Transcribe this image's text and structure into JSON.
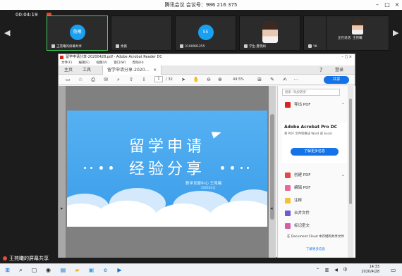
{
  "meeting": {
    "title": "腾讯会议 会议号：986 216 375",
    "timer": "00:04:19",
    "screen_share_label": "王苑曦的屏幕共享"
  },
  "participants": [
    {
      "avatar_text": "苑曦",
      "name": "王苑曦的屏幕共享",
      "avatar_color": "#1aa0f0",
      "active": true
    },
    {
      "avatar_text": "",
      "name": "余薇",
      "avatar_color": "#000000",
      "active": false
    },
    {
      "avatar_text": "55",
      "name": "3190901255",
      "avatar_color": "#1aa0f0",
      "active": false
    },
    {
      "avatar_text": "",
      "name": "学生·夏晓如",
      "avatar_color": "photo",
      "active": false
    },
    {
      "avatar_text": "",
      "name": "YK",
      "avatar_color": "#000000",
      "active": false
    },
    {
      "avatar_text": "",
      "name": "正在说话: 王苑曦",
      "avatar_color": "photo",
      "active": false
    }
  ],
  "acrobat": {
    "window_title": "留学申请分享-20200428.pdf - Adobe Acrobat Reader DC",
    "menu": [
      "文件(F)",
      "编辑(E)",
      "视图(V)",
      "窗口(W)",
      "帮助(H)"
    ],
    "tabs": {
      "home": "主页",
      "tools": "工具",
      "doc": "留学申请分享-2020..."
    },
    "login": "登录",
    "page_current": "1",
    "page_total": "/ 32",
    "zoom": "49.5%",
    "share": "共享"
  },
  "slide": {
    "line1": "留学申请",
    "line2": "经验分享",
    "subtitle": "教学发展中心 王苑曦",
    "date": "2020年4月"
  },
  "pane": {
    "search_placeholder": "搜索 '添加链接'",
    "export_pdf": "导出 PDF",
    "pro_title": "Adobe Acrobat Pro DC",
    "pro_desc": "将 PDF 文件转换成 Word 或 Excel",
    "pro_button": "了解更多信息",
    "create_pdf": "创建 PDF",
    "edit_pdf": "编辑 PDF",
    "comment": "注释",
    "combine": "合并文件",
    "redact": "标记密文",
    "footer": "在 Document Cloud 中存储和共享文件",
    "footer_link": "了解更多信息"
  },
  "taskbar": {
    "time": "14:33",
    "date": "2020/4/28"
  },
  "colors": {
    "accent_blue": "#1473e6",
    "slide_blue": "#4aa8ef",
    "active_green": "#3ed05d"
  }
}
